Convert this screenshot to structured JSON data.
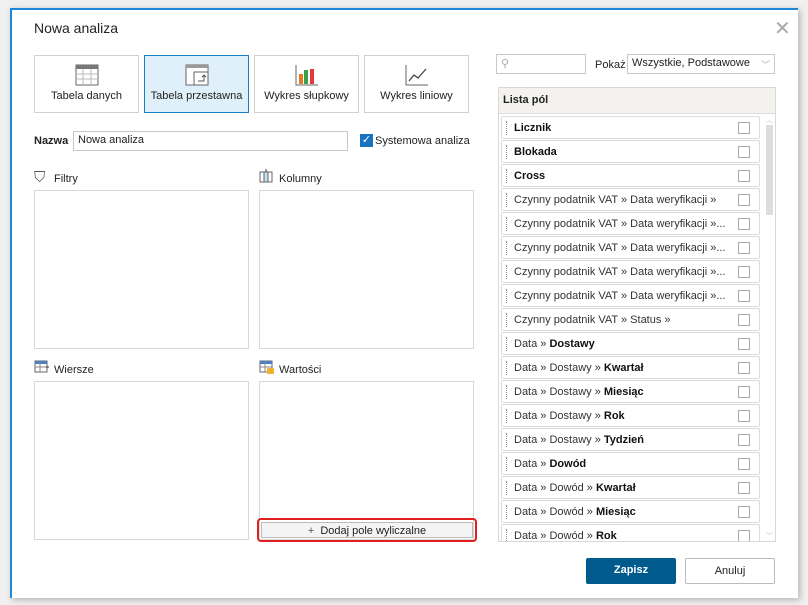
{
  "dialog": {
    "title": "Nowa analiza"
  },
  "types": [
    {
      "label": "Tabela danych",
      "icon": "data-table-icon"
    },
    {
      "label": "Tabela przestawna",
      "icon": "pivot-table-icon",
      "selected": true
    },
    {
      "label": "Wykres słupkowy",
      "icon": "bar-chart-icon"
    },
    {
      "label": "Wykres liniowy",
      "icon": "line-chart-icon"
    }
  ],
  "name": {
    "label": "Nazwa",
    "value": "Nowa analiza"
  },
  "system": {
    "label": "Systemowa analiza",
    "checked": true
  },
  "zones": {
    "filters": "Filtry",
    "columns": "Kolumny",
    "rows": "Wiersze",
    "values": "Wartości"
  },
  "add_calc": "Dodaj pole wyliczalne",
  "search": {
    "placeholder": ""
  },
  "show": {
    "label": "Pokaż",
    "value": "Wszystkie, Podstawowe"
  },
  "field_list": {
    "title": "Lista pól",
    "items": [
      {
        "pre": "",
        "bold": "Licznik"
      },
      {
        "pre": "",
        "bold": "Blokada"
      },
      {
        "pre": "",
        "bold": "Cross"
      },
      {
        "pre": "Czynny podatnik VAT » Data weryfikacji »",
        "bold": ""
      },
      {
        "pre": "Czynny podatnik VAT » Data weryfikacji »...",
        "bold": ""
      },
      {
        "pre": "Czynny podatnik VAT » Data weryfikacji »...",
        "bold": ""
      },
      {
        "pre": "Czynny podatnik VAT » Data weryfikacji »...",
        "bold": ""
      },
      {
        "pre": "Czynny podatnik VAT » Data weryfikacji »...",
        "bold": ""
      },
      {
        "pre": "Czynny podatnik VAT » Status »",
        "bold": ""
      },
      {
        "pre": "Data » ",
        "bold": "Dostawy"
      },
      {
        "pre": "Data » Dostawy » ",
        "bold": "Kwartał"
      },
      {
        "pre": "Data » Dostawy » ",
        "bold": "Miesiąc"
      },
      {
        "pre": "Data » Dostawy » ",
        "bold": "Rok"
      },
      {
        "pre": "Data » Dostawy » ",
        "bold": "Tydzień"
      },
      {
        "pre": "Data » ",
        "bold": "Dowód"
      },
      {
        "pre": "Data » Dowód » ",
        "bold": "Kwartał"
      },
      {
        "pre": "Data » Dowód » ",
        "bold": "Miesiąc"
      },
      {
        "pre": "Data » Dowód » ",
        "bold": "Rok"
      }
    ]
  },
  "buttons": {
    "save": "Zapisz",
    "cancel": "Anuluj"
  },
  "colors": {
    "accent": "#1e88d8",
    "primary": "#005a8c"
  }
}
